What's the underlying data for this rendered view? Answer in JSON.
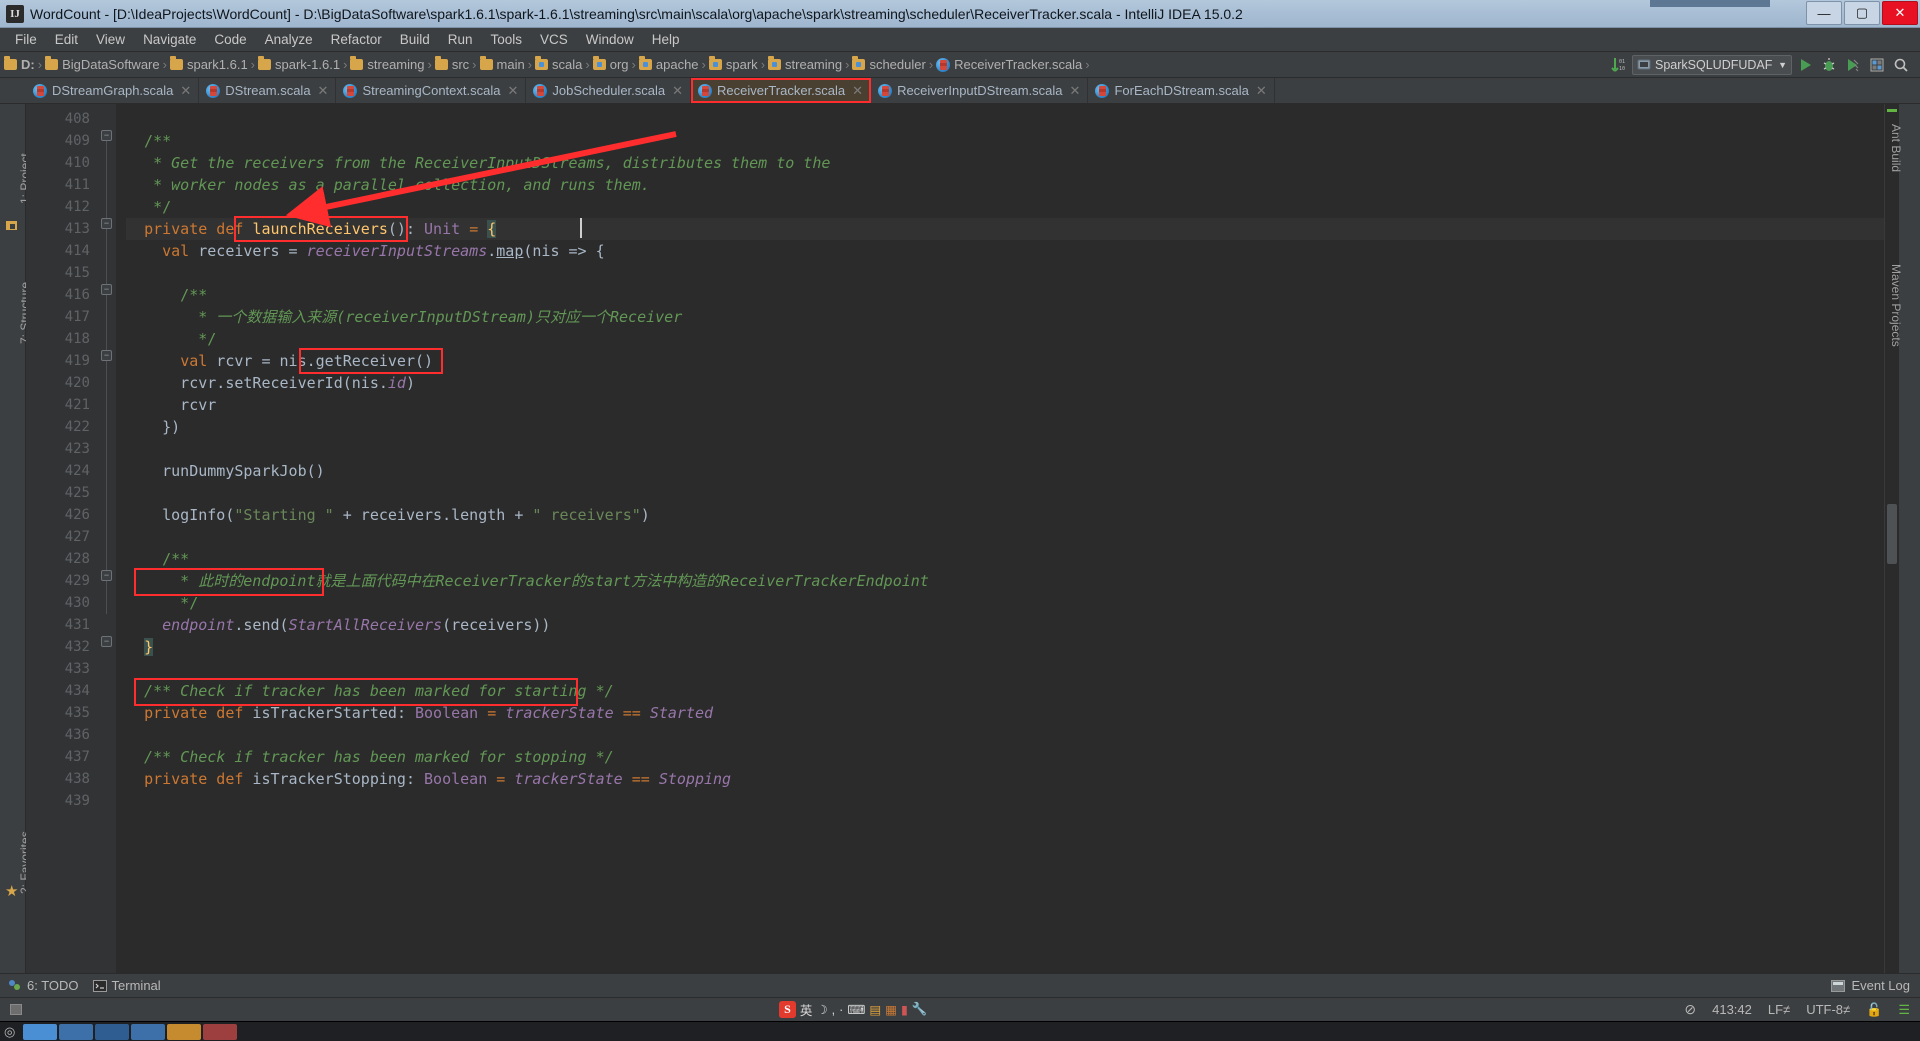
{
  "window": {
    "title": "WordCount - [D:\\IdeaProjects\\WordCount] - D:\\BigDataSoftware\\spark1.6.1\\spark-1.6.1\\streaming\\src\\main\\scala\\org\\apache\\spark\\streaming\\scheduler\\ReceiverTracker.scala - IntelliJ IDEA 15.0.2",
    "app_icon": "intellij-idea-icon",
    "minimize_label": "—",
    "maximize_label": "▢",
    "close_label": "✕"
  },
  "menubar": {
    "items": [
      {
        "label": "File"
      },
      {
        "label": "Edit"
      },
      {
        "label": "View"
      },
      {
        "label": "Navigate"
      },
      {
        "label": "Code"
      },
      {
        "label": "Analyze"
      },
      {
        "label": "Refactor"
      },
      {
        "label": "Build"
      },
      {
        "label": "Run"
      },
      {
        "label": "Tools"
      },
      {
        "label": "VCS"
      },
      {
        "label": "Window"
      },
      {
        "label": "Help"
      }
    ]
  },
  "navbar": {
    "breadcrumbs": [
      {
        "label": "D:",
        "icon": "folder-icon"
      },
      {
        "label": "BigDataSoftware",
        "icon": "folder-icon"
      },
      {
        "label": "spark1.6.1",
        "icon": "folder-icon"
      },
      {
        "label": "spark-1.6.1",
        "icon": "folder-icon"
      },
      {
        "label": "streaming",
        "icon": "folder-icon"
      },
      {
        "label": "src",
        "icon": "folder-icon"
      },
      {
        "label": "main",
        "icon": "folder-icon"
      },
      {
        "label": "scala",
        "icon": "source-folder-icon"
      },
      {
        "label": "org",
        "icon": "source-folder-icon"
      },
      {
        "label": "apache",
        "icon": "source-folder-icon"
      },
      {
        "label": "spark",
        "icon": "source-folder-icon"
      },
      {
        "label": "streaming",
        "icon": "source-folder-icon"
      },
      {
        "label": "scheduler",
        "icon": "source-folder-icon"
      },
      {
        "label": "ReceiverTracker.scala",
        "icon": "scala-file-icon"
      }
    ],
    "separator": "›",
    "run_configuration": "SparkSQLUDFUDAF",
    "run_configuration_caret": "▼",
    "toolbar_icons": [
      "sort-numeric-icon",
      "run-icon",
      "debug-icon",
      "coverage-icon",
      "layout-icon",
      "search-icon"
    ]
  },
  "tabs": [
    {
      "label": "DStreamGraph.scala",
      "icon": "scala-file-icon",
      "close": "✕",
      "active": false,
      "highlighted": false
    },
    {
      "label": "DStream.scala",
      "icon": "scala-file-icon",
      "close": "✕",
      "active": false,
      "highlighted": false
    },
    {
      "label": "StreamingContext.scala",
      "icon": "scala-file-icon",
      "close": "✕",
      "active": false,
      "highlighted": false
    },
    {
      "label": "JobScheduler.scala",
      "icon": "scala-file-icon",
      "close": "✕",
      "active": false,
      "highlighted": false
    },
    {
      "label": "ReceiverTracker.scala",
      "icon": "scala-file-icon",
      "close": "✕",
      "active": true,
      "highlighted": true
    },
    {
      "label": "ReceiverInputDStream.scala",
      "icon": "scala-file-icon",
      "close": "✕",
      "active": false,
      "highlighted": false
    },
    {
      "label": "ForEachDStream.scala",
      "icon": "scala-file-icon",
      "close": "✕",
      "active": false,
      "highlighted": false
    }
  ],
  "tool_strips": {
    "left": [
      {
        "label": "1: Project"
      },
      {
        "label": "7: Structure"
      },
      {
        "label": "2: Favorites"
      }
    ],
    "right": [
      {
        "label": "Ant Build"
      },
      {
        "label": "Maven Projects"
      }
    ]
  },
  "editor": {
    "first_line": 408,
    "lines": [
      {
        "n": 408,
        "text": ""
      },
      {
        "n": 409,
        "text": "  /**"
      },
      {
        "n": 410,
        "text": "   * Get the receivers from the ReceiverInputDStreams, distributes them to the"
      },
      {
        "n": 411,
        "text": "   * worker nodes as a parallel collection, and runs them."
      },
      {
        "n": 412,
        "text": "   */"
      },
      {
        "n": 413,
        "text": "  private def launchReceivers(): Unit = {"
      },
      {
        "n": 414,
        "text": "    val receivers = receiverInputStreams.map(nis => {"
      },
      {
        "n": 415,
        "text": ""
      },
      {
        "n": 416,
        "text": "      /**"
      },
      {
        "n": 417,
        "text": "        * 一个数据输入来源(receiverInputDStream)只对应一个Receiver"
      },
      {
        "n": 418,
        "text": "        */"
      },
      {
        "n": 419,
        "text": "      val rcvr = nis.getReceiver()"
      },
      {
        "n": 420,
        "text": "      rcvr.setReceiverId(nis.id)"
      },
      {
        "n": 421,
        "text": "      rcvr"
      },
      {
        "n": 422,
        "text": "    })"
      },
      {
        "n": 423,
        "text": ""
      },
      {
        "n": 424,
        "text": "    runDummySparkJob()"
      },
      {
        "n": 425,
        "text": ""
      },
      {
        "n": 426,
        "text": "    logInfo(\"Starting \" + receivers.length + \" receivers\")"
      },
      {
        "n": 427,
        "text": ""
      },
      {
        "n": 428,
        "text": "    /**"
      },
      {
        "n": 429,
        "text": "      * 此时的endpoint就是上面代码中在ReceiverTracker的start方法中构造的ReceiverTrackerEndpoint"
      },
      {
        "n": 430,
        "text": "      */"
      },
      {
        "n": 431,
        "text": "    endpoint.send(StartAllReceivers(receivers))"
      },
      {
        "n": 432,
        "text": "  }"
      },
      {
        "n": 433,
        "text": ""
      },
      {
        "n": 434,
        "text": "  /** Check if tracker has been marked for starting */"
      },
      {
        "n": 435,
        "text": "  private def isTrackerStarted: Boolean = trackerState == Started"
      },
      {
        "n": 436,
        "text": ""
      },
      {
        "n": 437,
        "text": "  /** Check if tracker has been marked for stopping */"
      },
      {
        "n": 438,
        "text": "  private def isTrackerStopping: Boolean = trackerState == Stopping"
      },
      {
        "n": 439,
        "text": ""
      }
    ],
    "annotations": {
      "red_boxes": [
        {
          "target": "tab-ReceiverTracker.scala"
        },
        {
          "target": "launchReceivers():"
        },
        {
          "target": "getReceiver()"
        },
        {
          "target": "runDummySparkJob()"
        },
        {
          "target": "endpoint.send(StartAllReceivers(receivers))"
        }
      ],
      "arrow": {
        "from": "line 410 right side",
        "to": "launchReceivers() box",
        "color": "#ff2d2d"
      }
    }
  },
  "bottom_tools": [
    {
      "label": "6: TODO",
      "icon": "todo-icon"
    },
    {
      "label": "Terminal",
      "icon": "terminal-icon"
    }
  ],
  "bottom_right": {
    "label": "Event Log",
    "icon": "event-log-icon"
  },
  "statusbar": {
    "caret_position": "413:42",
    "line_separator": "LF≠",
    "encoding": "UTF-8≠",
    "lock_icon": "unlocked-icon",
    "clock_icon": "inspection-icon"
  },
  "tray": {
    "ime_logo": "S",
    "ime_mode": "英",
    "items": [
      "moon-icon",
      "comma-icon",
      "dot-icon",
      "keyboard-icon",
      "palette-icon",
      "toolbox-icon",
      "trash-icon",
      "wrench-icon"
    ]
  },
  "colors": {
    "accent_red": "#ff2d2d",
    "editor_bg": "#2b2b2b",
    "gutter_bg": "#313335",
    "chrome_bg": "#3c3f41",
    "text": "#a9b7c6",
    "keyword": "#cc7832",
    "comment": "#629755",
    "string": "#6a8759",
    "function": "#ffc66d",
    "field": "#9876aa"
  }
}
